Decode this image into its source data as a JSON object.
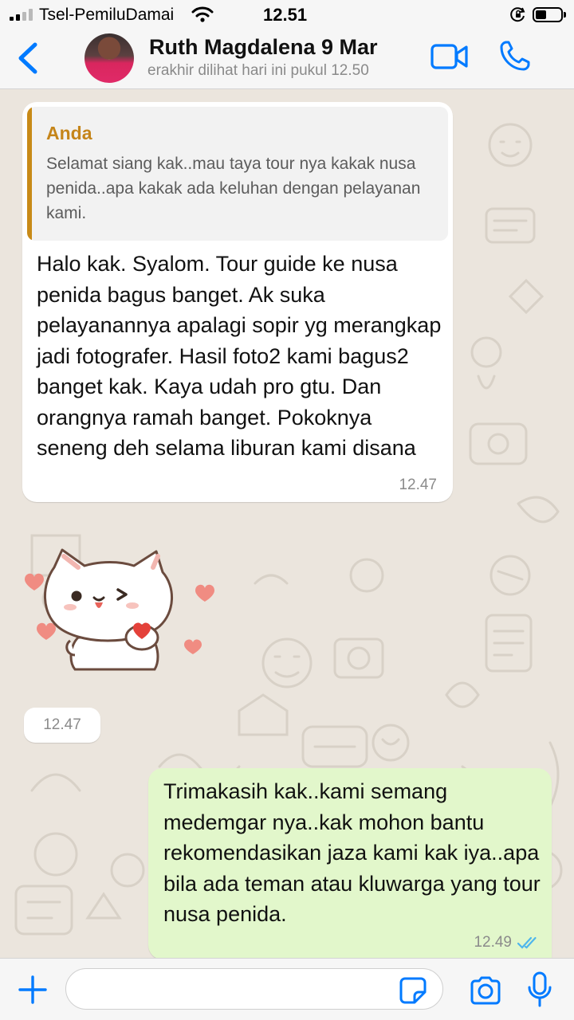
{
  "status_bar": {
    "carrier": "Tsel-PemiluDamai",
    "time": "12.51",
    "signal_bars": 2,
    "signal_total": 4
  },
  "header": {
    "contact_name": "Ruth Magdalena 9 Mar",
    "contact_status": "erakhir dilihat hari ini pukul 12.50",
    "icons": [
      "chevron-left-icon",
      "video-camera-icon",
      "phone-icon"
    ]
  },
  "chat": {
    "incoming": {
      "quote_author": "Anda",
      "quote_text": "Selamat siang kak..mau taya tour nya kakak nusa penida..apa kakak ada keluhan dengan pelayanan kami.",
      "text": "Halo kak. Syalom. Tour guide ke nusa penida bagus banget. Ak suka pelayanannya apalagi sopir yg merangkap jadi fotografer. Hasil foto2 kami bagus2 banget kak. Kaya udah pro gtu. Dan orangnya ramah banget. Pokoknya seneng deh selama liburan kami disana",
      "time": "12.47"
    },
    "sticker": {
      "icon": "cat-heart-sticker",
      "time": "12.47"
    },
    "outgoing": {
      "text": "Trimakasih kak..kami semang medemgar nya..kak mohon bantu rekomendasikan jaza kami kak iya..apa bila ada teman atau kluwarga yang tour nusa penida.",
      "time": "12.49",
      "status": "read"
    }
  },
  "input_bar": {
    "value": "",
    "icons": [
      "plus-icon",
      "sticker-icon",
      "camera-icon",
      "microphone-icon"
    ]
  },
  "colors": {
    "accent": "#007aff",
    "quote_author": "#c5851a",
    "outgoing_bubble": "#e2f7cb",
    "chat_background": "#ebe5dd",
    "read_ticks": "#4fb6ec"
  }
}
